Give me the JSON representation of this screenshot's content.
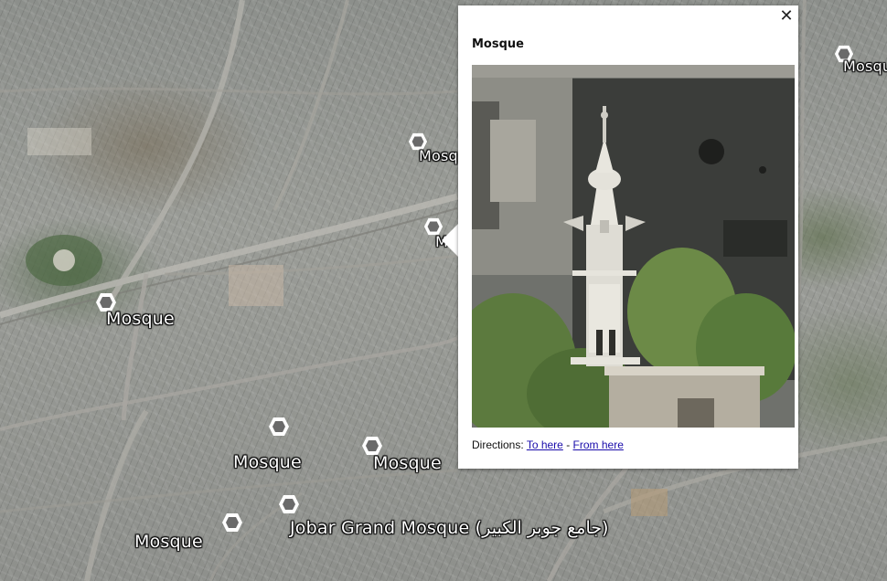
{
  "map": {
    "placemarks": [
      {
        "label": "Mosque",
        "icon": "hexagon-placemark-icon"
      },
      {
        "label": "Mosq",
        "icon": "hexagon-placemark-icon"
      },
      {
        "label": "M",
        "icon": "hexagon-placemark-icon"
      },
      {
        "label": "Mosque",
        "icon": "hexagon-placemark-icon"
      },
      {
        "label": "Mosque",
        "icon": "hexagon-placemark-icon"
      },
      {
        "label": "Mosque",
        "icon": "hexagon-placemark-icon"
      },
      {
        "label": "Jobar Grand Mosque (جامع جوبر الكبير)",
        "icon": "hexagon-placemark-icon"
      },
      {
        "label": "Mosque",
        "icon": "hexagon-placemark-icon"
      },
      {
        "label": "Mosqu",
        "icon": "hexagon-placemark-icon"
      }
    ]
  },
  "balloon": {
    "title": "Mosque",
    "close_label": "✕",
    "photo": "minaret-photo",
    "directions_label": "Directions:",
    "to_here": "To here",
    "separator": "-",
    "from_here": "From here"
  },
  "colors": {
    "link": "#1a0dab",
    "balloon_bg": "#ffffff",
    "label_text": "#ffffff"
  }
}
